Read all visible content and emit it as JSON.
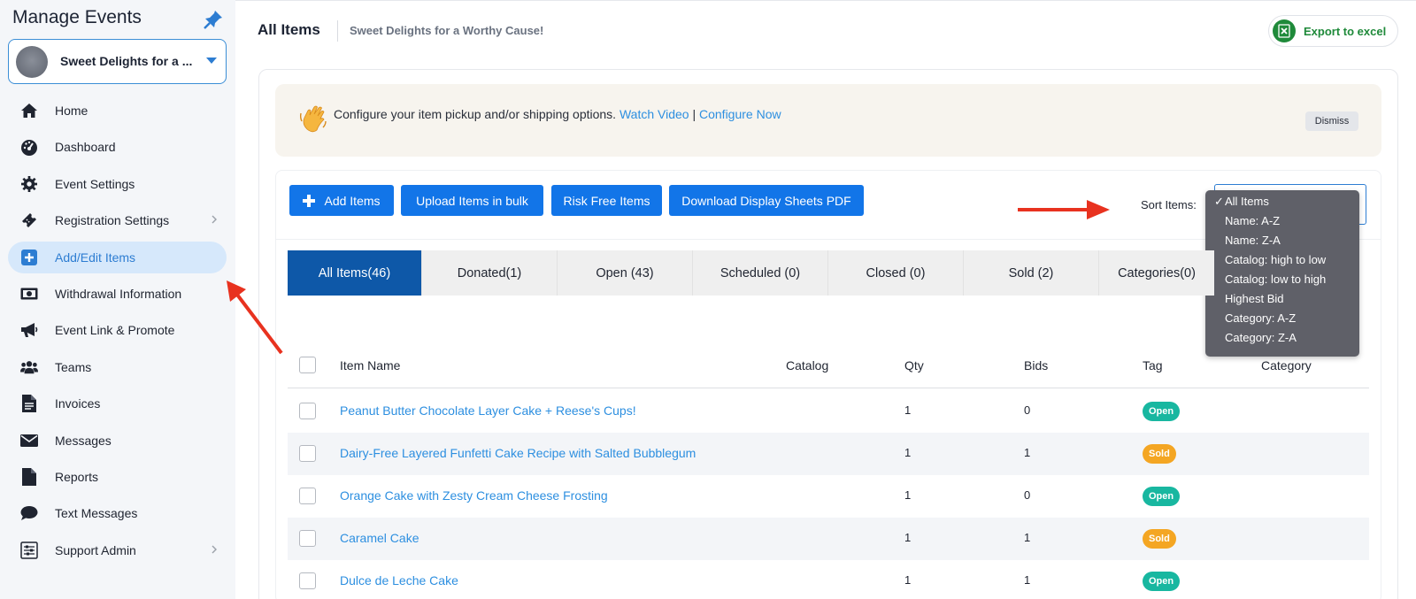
{
  "sidebar": {
    "title": "Manage Events",
    "event_name": "Sweet Delights for a ...",
    "items": [
      {
        "label": "Home",
        "icon": "home-icon"
      },
      {
        "label": "Dashboard",
        "icon": "dashboard-icon"
      },
      {
        "label": "Event Settings",
        "icon": "gear-icon"
      },
      {
        "label": "Registration Settings",
        "icon": "ticket-icon"
      },
      {
        "label": "Add/Edit Items",
        "icon": "plus-square-icon"
      },
      {
        "label": "Withdrawal Information",
        "icon": "money-icon"
      },
      {
        "label": "Event Link & Promote",
        "icon": "megaphone-icon"
      },
      {
        "label": "Teams",
        "icon": "users-icon"
      },
      {
        "label": "Invoices",
        "icon": "invoice-icon"
      },
      {
        "label": "Messages",
        "icon": "envelope-icon"
      },
      {
        "label": "Reports",
        "icon": "file-icon"
      },
      {
        "label": "Text Messages",
        "icon": "chat-icon"
      },
      {
        "label": "Support Admin",
        "icon": "sliders-icon"
      }
    ]
  },
  "header": {
    "title": "All Items",
    "subtitle": "Sweet Delights for a Worthy Cause!",
    "export_label": "Export to excel"
  },
  "notice": {
    "text": "Configure your item pickup and/or shipping options.",
    "watch_video": "Watch Video",
    "separator": "|",
    "configure_now": "Configure Now",
    "dismiss": "Dismiss"
  },
  "toolbar": {
    "add_items": "Add Items",
    "upload_bulk": "Upload Items in bulk",
    "risk_free": "Risk Free Items",
    "download_pdf": "Download Display Sheets PDF",
    "sort_label": "Sort Items:",
    "sort_options": [
      "All Items",
      "Name: A-Z",
      "Name: Z-A",
      "Catalog: high to low",
      "Catalog: low to high",
      "Highest Bid",
      "Category: A-Z",
      "Category: Z-A"
    ],
    "sort_selected": "All Items",
    "check_mark": "✓"
  },
  "tabs": [
    "All Items(46)",
    "Donated(1)",
    "Open (43)",
    "Scheduled (0)",
    "Closed (0)",
    "Sold (2)",
    "Categories(0)"
  ],
  "table": {
    "columns": [
      "Item Name",
      "Catalog",
      "Qty",
      "Bids",
      "Tag",
      "Category"
    ],
    "rows": [
      {
        "name": "Peanut Butter Chocolate Layer Cake + Reese's Cups!",
        "catalog": "",
        "qty": "1",
        "bids": "0",
        "tag": "Open"
      },
      {
        "name": "Dairy-Free Layered Funfetti Cake Recipe with Salted Bubblegum",
        "catalog": "",
        "qty": "1",
        "bids": "1",
        "tag": "Sold"
      },
      {
        "name": "Orange Cake with Zesty Cream Cheese Frosting",
        "catalog": "",
        "qty": "1",
        "bids": "0",
        "tag": "Open"
      },
      {
        "name": "Caramel Cake",
        "catalog": "",
        "qty": "1",
        "bids": "1",
        "tag": "Sold"
      },
      {
        "name": "Dulce de Leche Cake",
        "catalog": "",
        "qty": "1",
        "bids": "1",
        "tag": "Open"
      }
    ]
  },
  "colors": {
    "primary": "#1275e8",
    "tab_active": "#0e58a8",
    "link": "#2d8fe0",
    "tag_open": "#18b7a0",
    "tag_sold": "#f4a623",
    "annotation_arrow": "#e8321f"
  }
}
